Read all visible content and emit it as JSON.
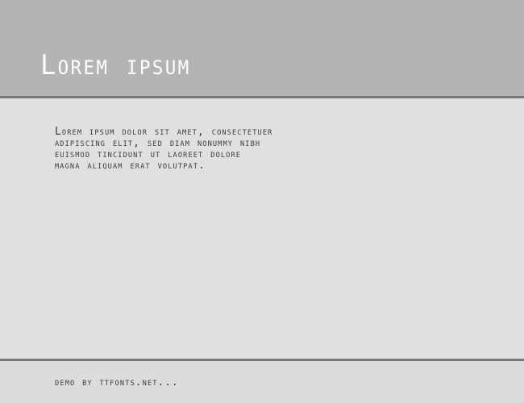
{
  "header": {
    "title": "Lorem ipsum",
    "background_color": "#b4b4b4",
    "text_color": "#ffffff",
    "rule_color": "#787878"
  },
  "body": {
    "background_color": "#e0e0e0",
    "text_color": "#3c3c3c",
    "sample_lines": [
      "Lorem ipsum dolor sit amet, consectetuer",
      "adipiscing elit, sed diam nonummy nibh",
      "euismod tincidunt ut laoreet dolore",
      "magna aliquam erat volutpat."
    ]
  },
  "footer": {
    "credit": "demo by ttfonts.net...",
    "background_color": "#dcdcdc",
    "text_color": "#3c3c3c",
    "rule_color": "#787878"
  }
}
